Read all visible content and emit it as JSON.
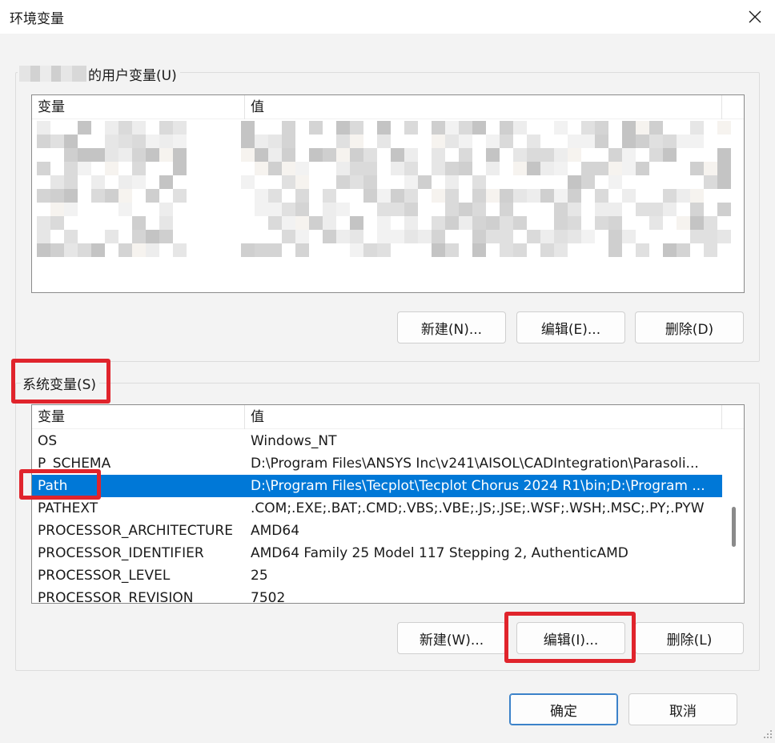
{
  "window": {
    "title": "环境变量",
    "close_icon": "close-icon"
  },
  "user_section": {
    "label": "的用户变量(U)",
    "columns": [
      "变量",
      "值"
    ],
    "buttons": {
      "new": "新建(N)...",
      "edit": "编辑(E)...",
      "delete": "删除(D)"
    }
  },
  "system_section": {
    "label": "系统变量(S)",
    "columns": [
      "变量",
      "值"
    ],
    "rows": [
      {
        "name": "OS",
        "value": "Windows_NT"
      },
      {
        "name": "P_SCHEMA",
        "value": "D:\\Program Files\\ANSYS Inc\\v241\\AISOL\\CADIntegration\\Parasoli..."
      },
      {
        "name": "Path",
        "value": "D:\\Program Files\\Tecplot\\Tecplot Chorus 2024 R1\\bin;D:\\Program ..."
      },
      {
        "name": "PATHEXT",
        "value": ".COM;.EXE;.BAT;.CMD;.VBS;.VBE;.JS;.JSE;.WSF;.WSH;.MSC;.PY;.PYW"
      },
      {
        "name": "PROCESSOR_ARCHITECTURE",
        "value": "AMD64"
      },
      {
        "name": "PROCESSOR_IDENTIFIER",
        "value": "AMD64 Family 25 Model 117 Stepping 2, AuthenticAMD"
      },
      {
        "name": "PROCESSOR_LEVEL",
        "value": "25"
      },
      {
        "name": "PROCESSOR_REVISION",
        "value": "7502"
      }
    ],
    "selected_row": "Path",
    "buttons": {
      "new": "新建(W)...",
      "edit": "编辑(I)...",
      "delete": "删除(L)"
    }
  },
  "footer": {
    "ok": "确定",
    "cancel": "取消"
  },
  "colors": {
    "selection": "#0078d7",
    "highlight_box": "#e0242c"
  }
}
